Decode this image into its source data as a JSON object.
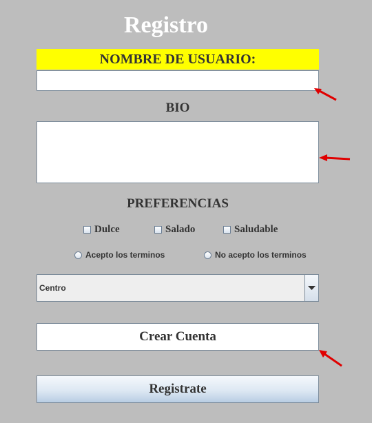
{
  "form": {
    "title": "Registro",
    "username_label": "NOMBRE DE USUARIO:",
    "username_value": "",
    "bio_label": "BIO",
    "bio_value": "",
    "preferences_label": "PREFERENCIAS",
    "checkboxes": [
      {
        "label": "Dulce",
        "checked": false
      },
      {
        "label": "Salado",
        "checked": false
      },
      {
        "label": "Saludable",
        "checked": false
      }
    ],
    "radios": [
      {
        "label": "Acepto los terminos",
        "selected": false
      },
      {
        "label": "No acepto los terminos",
        "selected": false
      }
    ],
    "select_value": "Centro",
    "create_button": "Crear Cuenta",
    "register_button": "Registrate"
  },
  "colors": {
    "background": "#bdbdbd",
    "highlight": "#ffff00",
    "annotation_arrow": "#e00000"
  }
}
